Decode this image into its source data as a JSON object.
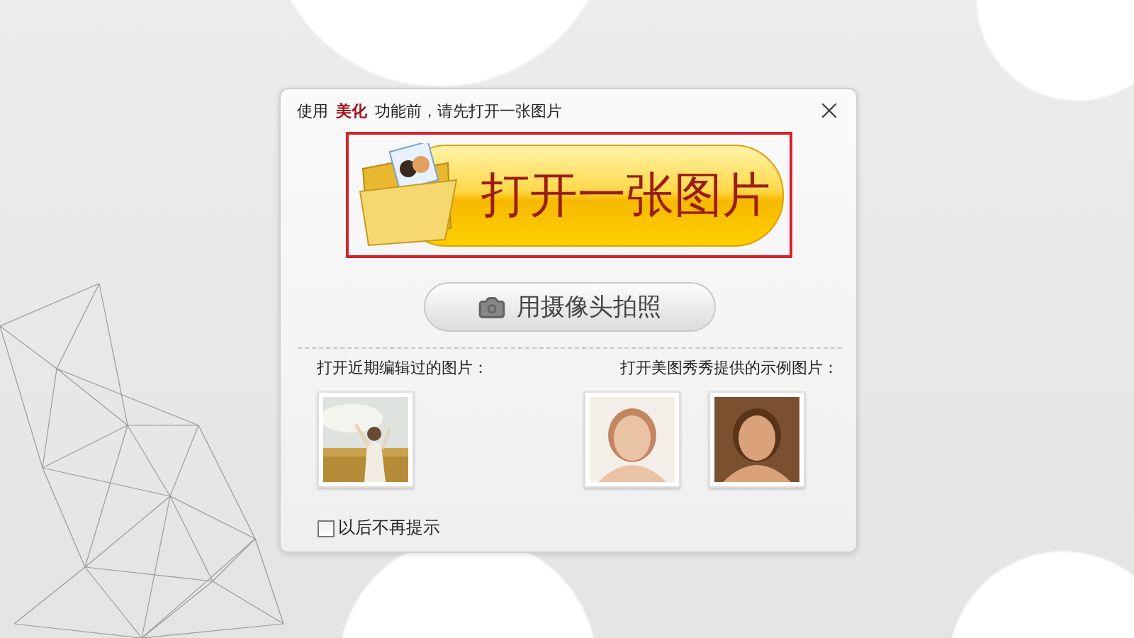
{
  "dialog": {
    "prompt": "使用 **美化** 功能前，请先打开一张图片",
    "open_button": {
      "label": "打开一张图片",
      "highlighted": true
    },
    "camera_button": {
      "label": "用摄像头拍照"
    },
    "recent": {
      "heading": "打开近期编辑过的图片："
    },
    "samples": {
      "heading": "打开美图秀秀提供的示例图片："
    },
    "dont_show_again": {
      "label": "以后不再提示",
      "checked": false
    }
  }
}
